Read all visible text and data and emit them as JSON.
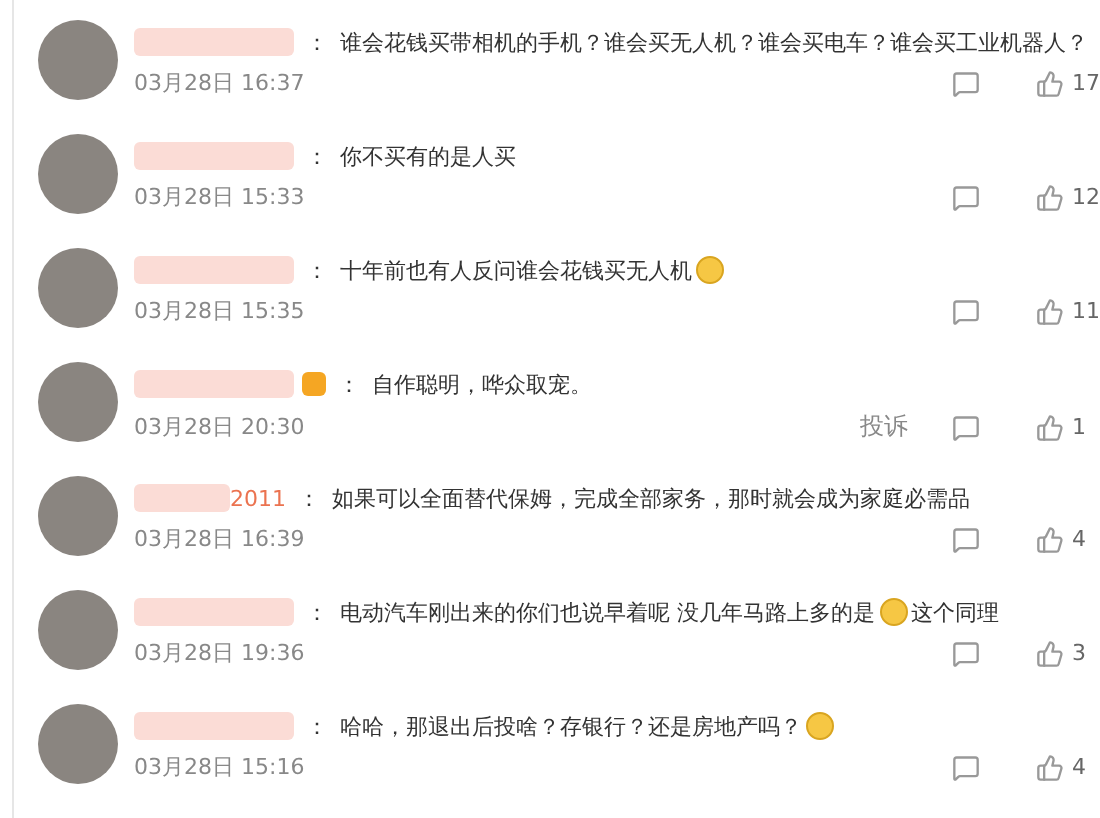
{
  "comments": [
    {
      "crown_badge": false,
      "separator": "：",
      "parts": [
        {
          "kind": "text",
          "text": "谁会花钱买带相机的手机？谁会买无人机？谁会买电车？谁会买工业机器人？"
        }
      ],
      "date": "03月28日 16:37",
      "likes": "17"
    },
    {
      "crown_badge": false,
      "separator": "：",
      "parts": [
        {
          "kind": "text",
          "text": "你不买有的是人买"
        }
      ],
      "date": "03月28日 15:33",
      "likes": "12"
    },
    {
      "crown_badge": false,
      "separator": "：",
      "parts": [
        {
          "kind": "text",
          "text": "十年前也有人反问谁会花钱买无人机"
        },
        {
          "kind": "emoji"
        }
      ],
      "date": "03月28日 15:35",
      "likes": "11"
    },
    {
      "crown_badge": true,
      "separator": "：",
      "parts": [
        {
          "kind": "text",
          "text": "自作聪明，哗众取宠。"
        }
      ],
      "date": "03月28日 20:30",
      "report": "投诉",
      "likes": "1"
    },
    {
      "name_suffix": "2011",
      "crown_badge": false,
      "separator": "：",
      "parts": [
        {
          "kind": "text",
          "text": "如果可以全面替代保姆，完成全部家务，那时就会成为家庭必需品"
        }
      ],
      "date": "03月28日 16:39",
      "likes": "4"
    },
    {
      "crown_badge": false,
      "separator": "：",
      "parts": [
        {
          "kind": "text",
          "text": "电动汽车刚出来的你们也说早着呢 没几年马路上多的是"
        },
        {
          "kind": "emoji"
        },
        {
          "kind": "text",
          "text": "这个同理"
        }
      ],
      "date": "03月28日 19:36",
      "likes": "3"
    },
    {
      "crown_badge": false,
      "separator": "：",
      "parts": [
        {
          "kind": "text",
          "text": "哈哈，那退出后投啥？存银行？还是房地产吗？"
        },
        {
          "kind": "emoji"
        }
      ],
      "date": "03月28日 15:16",
      "likes": "4"
    }
  ]
}
